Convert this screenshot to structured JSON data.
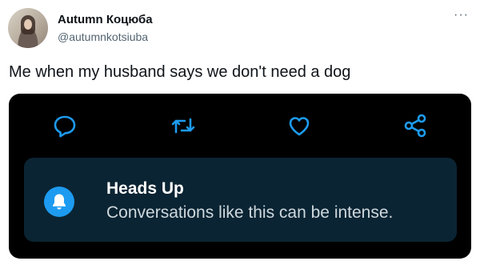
{
  "author": {
    "display_name": "Autumn Коцюба",
    "handle": "@autumnkotsiuba"
  },
  "more_label": "···",
  "tweet": {
    "text": "Me when my husband says we don't need a dog"
  },
  "media": {
    "actions": [
      {
        "name": "reply",
        "icon": "comment-icon"
      },
      {
        "name": "retweet",
        "icon": "retweet-icon"
      },
      {
        "name": "like",
        "icon": "heart-icon"
      },
      {
        "name": "share",
        "icon": "share-icon"
      }
    ],
    "notice": {
      "title": "Heads Up",
      "body": "Conversations like this can be intense.",
      "icon": "bell-icon",
      "accent": "#1d9bf0"
    }
  },
  "colors": {
    "media_bg": "#000000",
    "notice_bg": "#0b2433",
    "icon_stroke": "#1d9bf0",
    "secondary_text": "#536471"
  }
}
